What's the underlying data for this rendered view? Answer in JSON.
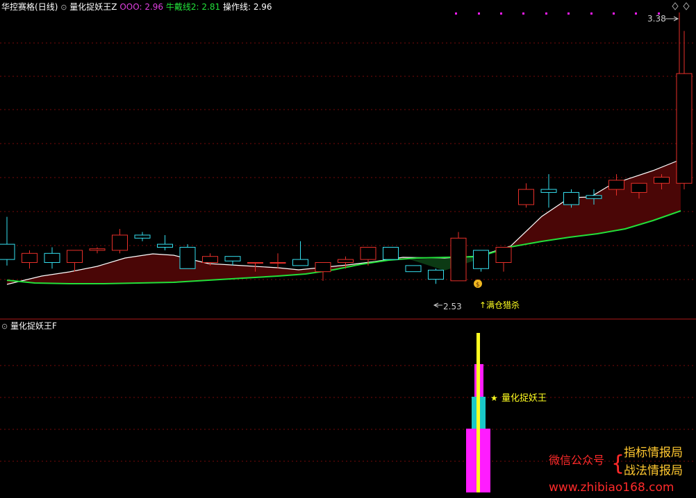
{
  "header": {
    "stock_name": "华控赛格",
    "period": "(日线)",
    "indicator_name": "量化捉妖王Z",
    "ooo_label": "OOO:",
    "ooo_value": "2.96",
    "bull_label": "牛戴线2:",
    "bull_value": "2.81",
    "op_label": "操作线:",
    "op_value": "2.96"
  },
  "sub_header": {
    "indicator_name": "量化捉妖王F"
  },
  "annotations": {
    "high_label": "3.38",
    "low_label": "2.53",
    "full_position_label": "满仓猎杀",
    "signal_label": "量化捉妖王"
  },
  "watermark": {
    "wechat_label": "微信公众号",
    "account_1": "指标情报局",
    "account_2": "战法情报局",
    "website": "www.zhibiao168.com"
  },
  "colors": {
    "up_candle": "#e8302a",
    "down_candle": "#35e0f0",
    "white_line": "#ffffff",
    "green_line": "#22e03a",
    "fill_dark_red": "#4a0606",
    "fill_dark_green": "#0c3a14",
    "grid": "#7a0a0a",
    "magenta": "#ff1cff",
    "cyan": "#19c8c8",
    "yellow": "#ffff20",
    "wechat_red": "#ff2a2a",
    "account_gold": "#ffc830",
    "header_magenta": "#e040e0",
    "header_green": "#22e03a"
  },
  "chart_data": {
    "type": "candlestick",
    "ylim": [
      2.48,
      3.42
    ],
    "candles": [
      {
        "o": 2.68,
        "h": 2.77,
        "l": 2.61,
        "c": 2.63
      },
      {
        "o": 2.62,
        "h": 2.66,
        "l": 2.6,
        "c": 2.65
      },
      {
        "o": 2.65,
        "h": 2.67,
        "l": 2.6,
        "c": 2.62
      },
      {
        "o": 2.62,
        "h": 2.66,
        "l": 2.59,
        "c": 2.66
      },
      {
        "o": 2.66,
        "h": 2.67,
        "l": 2.65,
        "c": 2.665
      },
      {
        "o": 2.66,
        "h": 2.73,
        "l": 2.65,
        "c": 2.71
      },
      {
        "o": 2.71,
        "h": 2.72,
        "l": 2.69,
        "c": 2.7
      },
      {
        "o": 2.68,
        "h": 2.71,
        "l": 2.66,
        "c": 2.67
      },
      {
        "o": 2.67,
        "h": 2.68,
        "l": 2.6,
        "c": 2.6
      },
      {
        "o": 2.62,
        "h": 2.65,
        "l": 2.61,
        "c": 2.64
      },
      {
        "o": 2.64,
        "h": 2.64,
        "l": 2.61,
        "c": 2.625
      },
      {
        "o": 2.62,
        "h": 2.62,
        "l": 2.59,
        "c": 2.62
      },
      {
        "o": 2.62,
        "h": 2.65,
        "l": 2.6,
        "c": 2.62
      },
      {
        "o": 2.63,
        "h": 2.69,
        "l": 2.61,
        "c": 2.61
      },
      {
        "o": 2.59,
        "h": 2.62,
        "l": 2.56,
        "c": 2.62
      },
      {
        "o": 2.62,
        "h": 2.64,
        "l": 2.6,
        "c": 2.63
      },
      {
        "o": 2.63,
        "h": 2.67,
        "l": 2.61,
        "c": 2.67
      },
      {
        "o": 2.67,
        "h": 2.67,
        "l": 2.63,
        "c": 2.63
      },
      {
        "o": 2.61,
        "h": 2.61,
        "l": 2.59,
        "c": 2.59
      },
      {
        "o": 2.595,
        "h": 2.6,
        "l": 2.55,
        "c": 2.565
      },
      {
        "o": 2.56,
        "h": 2.72,
        "l": 2.56,
        "c": 2.7
      },
      {
        "o": 2.66,
        "h": 2.66,
        "l": 2.59,
        "c": 2.6
      },
      {
        "o": 2.62,
        "h": 2.67,
        "l": 2.59,
        "c": 2.67
      },
      {
        "o": 2.81,
        "h": 2.88,
        "l": 2.8,
        "c": 2.86
      },
      {
        "o": 2.86,
        "h": 2.91,
        "l": 2.8,
        "c": 2.85
      },
      {
        "o": 2.85,
        "h": 2.86,
        "l": 2.8,
        "c": 2.81
      },
      {
        "o": 2.84,
        "h": 2.86,
        "l": 2.81,
        "c": 2.83
      },
      {
        "o": 2.86,
        "h": 2.91,
        "l": 2.84,
        "c": 2.89
      },
      {
        "o": 2.85,
        "h": 2.88,
        "l": 2.83,
        "c": 2.88
      },
      {
        "o": 2.88,
        "h": 2.91,
        "l": 2.86,
        "c": 2.9
      },
      {
        "o": 2.88,
        "h": 3.38,
        "l": 2.86,
        "c": 3.24
      }
    ]
  }
}
